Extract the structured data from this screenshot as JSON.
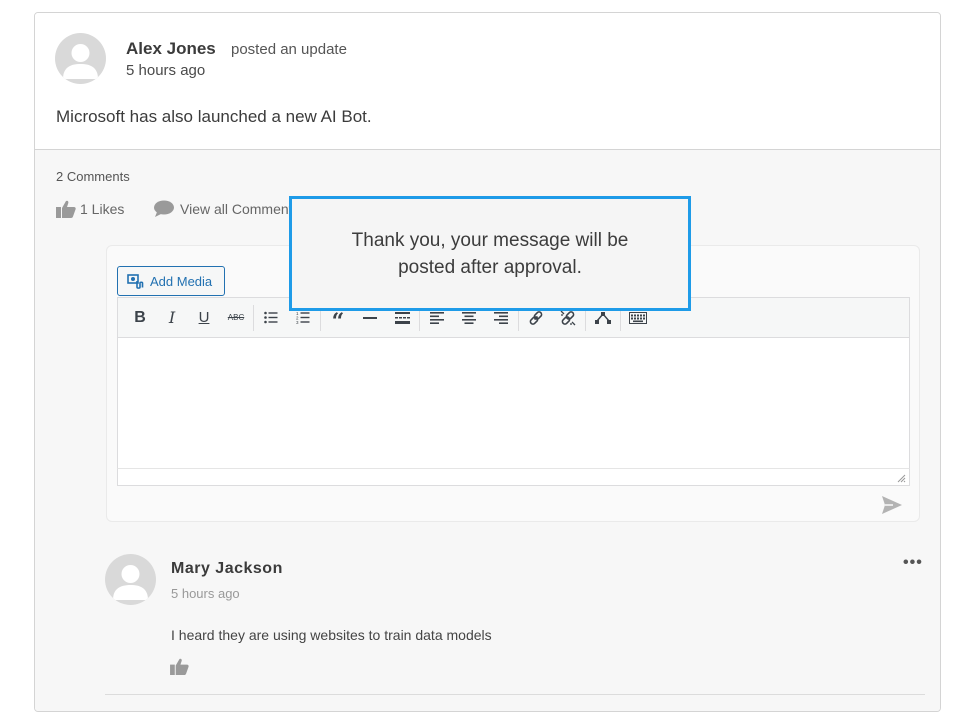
{
  "post": {
    "author": "Alex Jones",
    "action": "posted an update",
    "time": "5 hours ago",
    "text": "Microsoft has also launched a new AI Bot."
  },
  "stats": {
    "comments_count": "2 Comments",
    "likes_label": "1 Likes",
    "view_all_label": "View all Comments"
  },
  "editor": {
    "add_media_label": "Add Media",
    "toolbar_buttons": [
      "bold",
      "italic",
      "underline",
      "strikethrough",
      "bulleted-list",
      "numbered-list",
      "blockquote",
      "horizontal-line",
      "insert-read-more",
      "align-left",
      "align-center",
      "align-right",
      "insert-link",
      "remove-link",
      "toolbar-toggle",
      "keyboard"
    ]
  },
  "modal": {
    "message": "Thank you, your message will be posted after approval."
  },
  "comment": {
    "author": "Mary Jackson",
    "time": "5 hours ago",
    "text": "I heard they are using websites to train data models",
    "more_label": "•••"
  },
  "colors": {
    "accent": "#1e9be8",
    "link_blue": "#2271b1"
  }
}
